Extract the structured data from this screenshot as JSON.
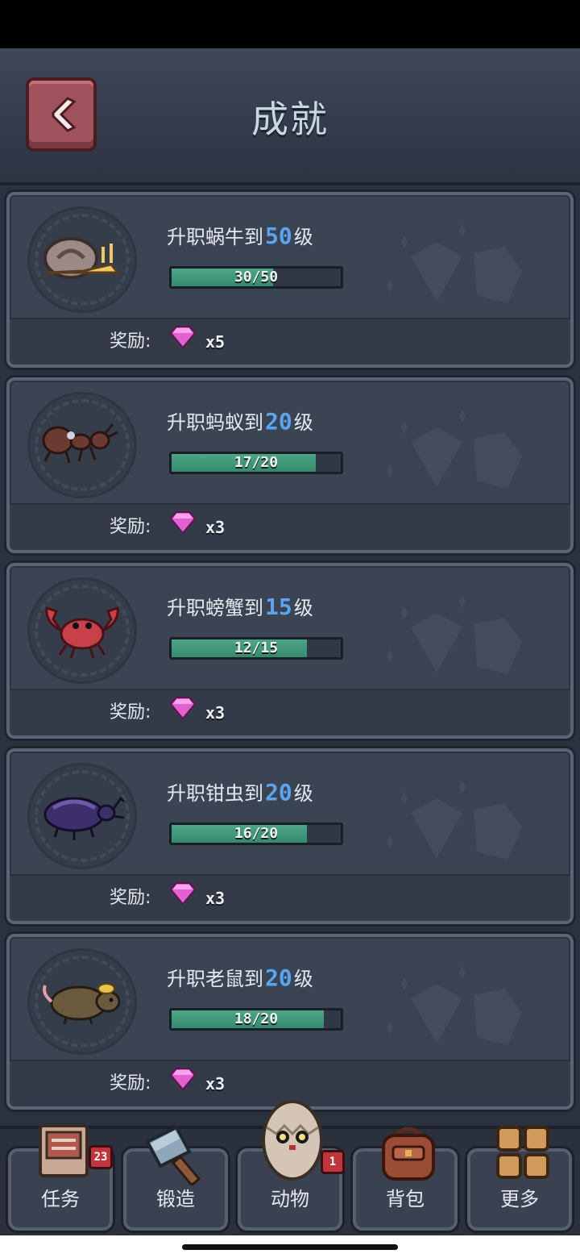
{
  "header": {
    "title": "成就",
    "back_icon": "chevron-left-icon"
  },
  "achievements": [
    {
      "prefix": "升职蜗牛到",
      "level": "50",
      "suffix": "级",
      "progress_text": "30/50",
      "progress": 0.6,
      "reward_label": "奖励:",
      "reward_count": "x5",
      "animal": "snail-icon"
    },
    {
      "prefix": "升职蚂蚁到",
      "level": "20",
      "suffix": "级",
      "progress_text": "17/20",
      "progress": 0.85,
      "reward_label": "奖励:",
      "reward_count": "x3",
      "animal": "ant-icon"
    },
    {
      "prefix": "升职螃蟹到",
      "level": "15",
      "suffix": "级",
      "progress_text": "12/15",
      "progress": 0.8,
      "reward_label": "奖励:",
      "reward_count": "x3",
      "animal": "crab-icon"
    },
    {
      "prefix": "升职钳虫到",
      "level": "20",
      "suffix": "级",
      "progress_text": "16/20",
      "progress": 0.8,
      "reward_label": "奖励:",
      "reward_count": "x3",
      "animal": "beetle-icon"
    },
    {
      "prefix": "升职老鼠到",
      "level": "20",
      "suffix": "级",
      "progress_text": "18/20",
      "progress": 0.9,
      "reward_label": "奖励:",
      "reward_count": "x3",
      "animal": "mouse-icon"
    }
  ],
  "nav": [
    {
      "label": "任务",
      "icon": "task-book-icon",
      "badge": "23"
    },
    {
      "label": "锻造",
      "icon": "hammer-icon",
      "badge": ""
    },
    {
      "label": "动物",
      "icon": "egg-creature-icon",
      "badge": "1"
    },
    {
      "label": "背包",
      "icon": "backpack-icon",
      "badge": ""
    },
    {
      "label": "更多",
      "icon": "grid-icon",
      "badge": ""
    }
  ],
  "colors": {
    "accent_level": "#5aa4f0",
    "progress_fill": "#4da685",
    "gem": "#e45fd0",
    "badge": "#c0343b"
  }
}
